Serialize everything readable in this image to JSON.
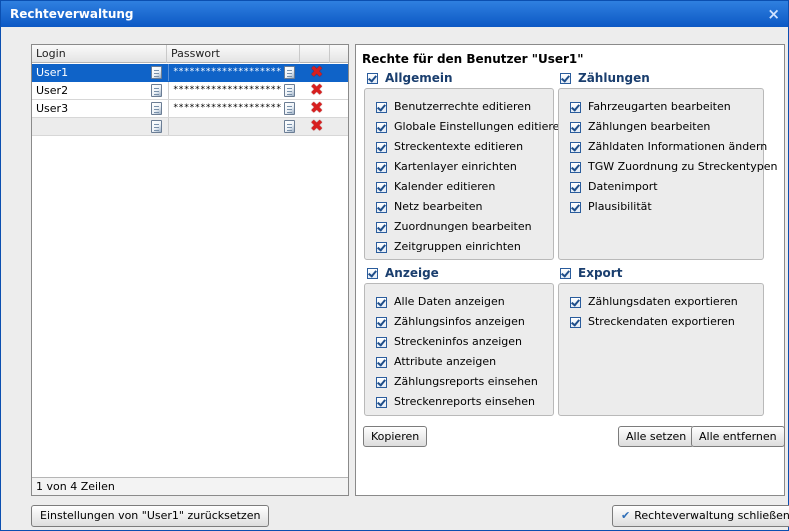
{
  "window": {
    "title": "Rechteverwaltung",
    "close_glyph": "×"
  },
  "grid": {
    "columns": [
      "Login",
      "Passwort"
    ],
    "rows": [
      {
        "login": "User1",
        "password": "********************",
        "selected": true
      },
      {
        "login": "User2",
        "password": "********************",
        "selected": false
      },
      {
        "login": "User3",
        "password": "********************",
        "selected": false
      },
      {
        "login": "",
        "password": "",
        "selected": false
      }
    ],
    "footer": "1 von 4 Zeilen",
    "delete_glyph": "✖"
  },
  "rights": {
    "title": "Rechte für den Benutzer \"User1\"",
    "groups": {
      "allgemein": {
        "label": "Allgemein",
        "items": [
          "Benutzerrechte editieren",
          "Globale Einstellungen editieren",
          "Streckentexte editieren",
          "Kartenlayer einrichten",
          "Kalender editieren",
          "Netz bearbeiten",
          "Zuordnungen bearbeiten",
          "Zeitgruppen einrichten"
        ]
      },
      "zaehlungen": {
        "label": "Zählungen",
        "items": [
          "Fahrzeugarten bearbeiten",
          "Zählungen bearbeiten",
          "Zähldaten Informationen ändern",
          "TGW Zuordnung zu Streckentypen",
          "Datenimport",
          "Plausibilität"
        ]
      },
      "anzeige": {
        "label": "Anzeige",
        "items": [
          "Alle Daten anzeigen",
          "Zählungsinfos anzeigen",
          "Streckeninfos anzeigen",
          "Attribute anzeigen",
          "Zählungsreports einsehen",
          "Streckenreports einsehen"
        ]
      },
      "export": {
        "label": "Export",
        "items": [
          "Zählungsdaten exportieren",
          "Streckendaten exportieren"
        ]
      }
    },
    "buttons": {
      "copy": "Kopieren",
      "set_all": "Alle setzen",
      "remove_all": "Alle entfernen"
    }
  },
  "bottom": {
    "reset_label": "Einstellungen von \"User1\" zurücksetzen",
    "close_label": "Rechteverwaltung schließen",
    "close_icon_glyph": "✔"
  },
  "colors": {
    "titlebar": "#0c58c4",
    "selection": "#0f63c8",
    "delete": "#d81f1f"
  }
}
